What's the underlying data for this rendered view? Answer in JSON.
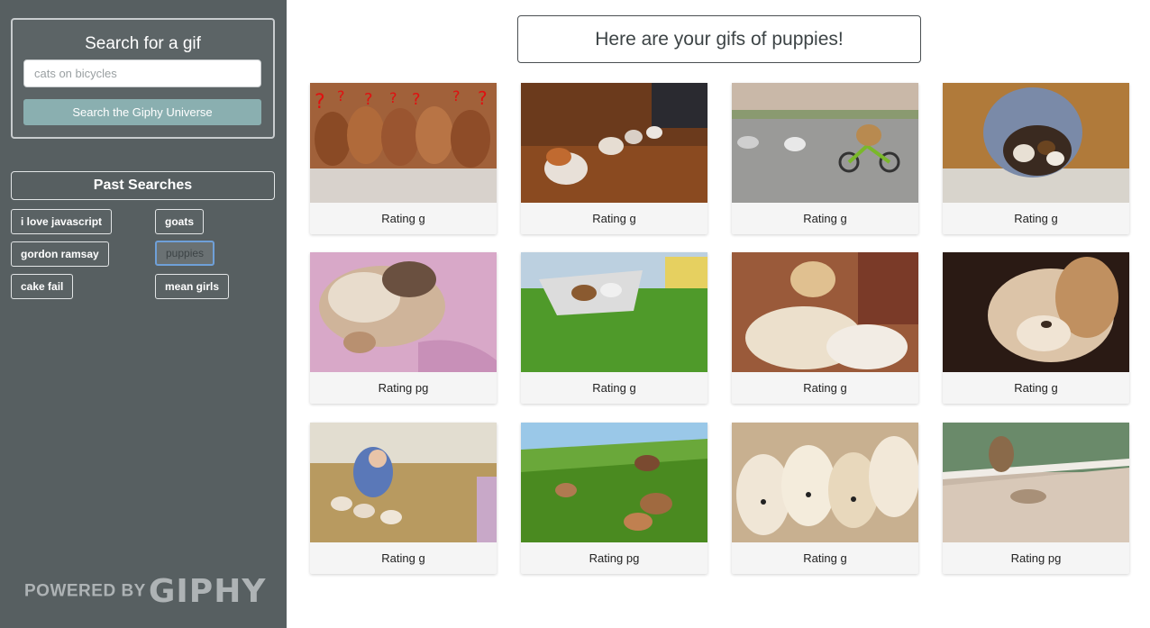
{
  "sidebar": {
    "search_title": "Search for a gif",
    "search_placeholder": "cats on bicycles",
    "search_button": "Search the Giphy Universe",
    "past_searches_title": "Past Searches",
    "past_searches": [
      {
        "label": "i love javascript",
        "active": false
      },
      {
        "label": "goats",
        "active": false
      },
      {
        "label": "gordon ramsay",
        "active": false
      },
      {
        "label": "puppies",
        "active": true
      },
      {
        "label": "cake fail",
        "active": false
      },
      {
        "label": "mean girls",
        "active": false
      }
    ],
    "powered_by": "POWERED BY",
    "brand": "GIPHY"
  },
  "main": {
    "heading": "Here are your gifs of puppies!",
    "gifs": [
      {
        "rating": "Rating g",
        "theme": "puppies-lineup"
      },
      {
        "rating": "Rating g",
        "theme": "corgi-puppies-running"
      },
      {
        "rating": "Rating g",
        "theme": "puppy-on-bike"
      },
      {
        "rating": "Rating g",
        "theme": "puppies-in-dome-bed"
      },
      {
        "rating": "Rating pg",
        "theme": "sleeping-puppy-blanket"
      },
      {
        "rating": "Rating g",
        "theme": "puppies-in-basket"
      },
      {
        "rating": "Rating g",
        "theme": "golden-puppies-pile"
      },
      {
        "rating": "Rating g",
        "theme": "sleepy-puppy-closeup"
      },
      {
        "rating": "Rating g",
        "theme": "person-with-puppies"
      },
      {
        "rating": "Rating pg",
        "theme": "dachshunds-hotdog-costumes"
      },
      {
        "rating": "Rating g",
        "theme": "golden-retriever-puppies"
      },
      {
        "rating": "Rating pg",
        "theme": "monkey-on-deck"
      }
    ]
  }
}
